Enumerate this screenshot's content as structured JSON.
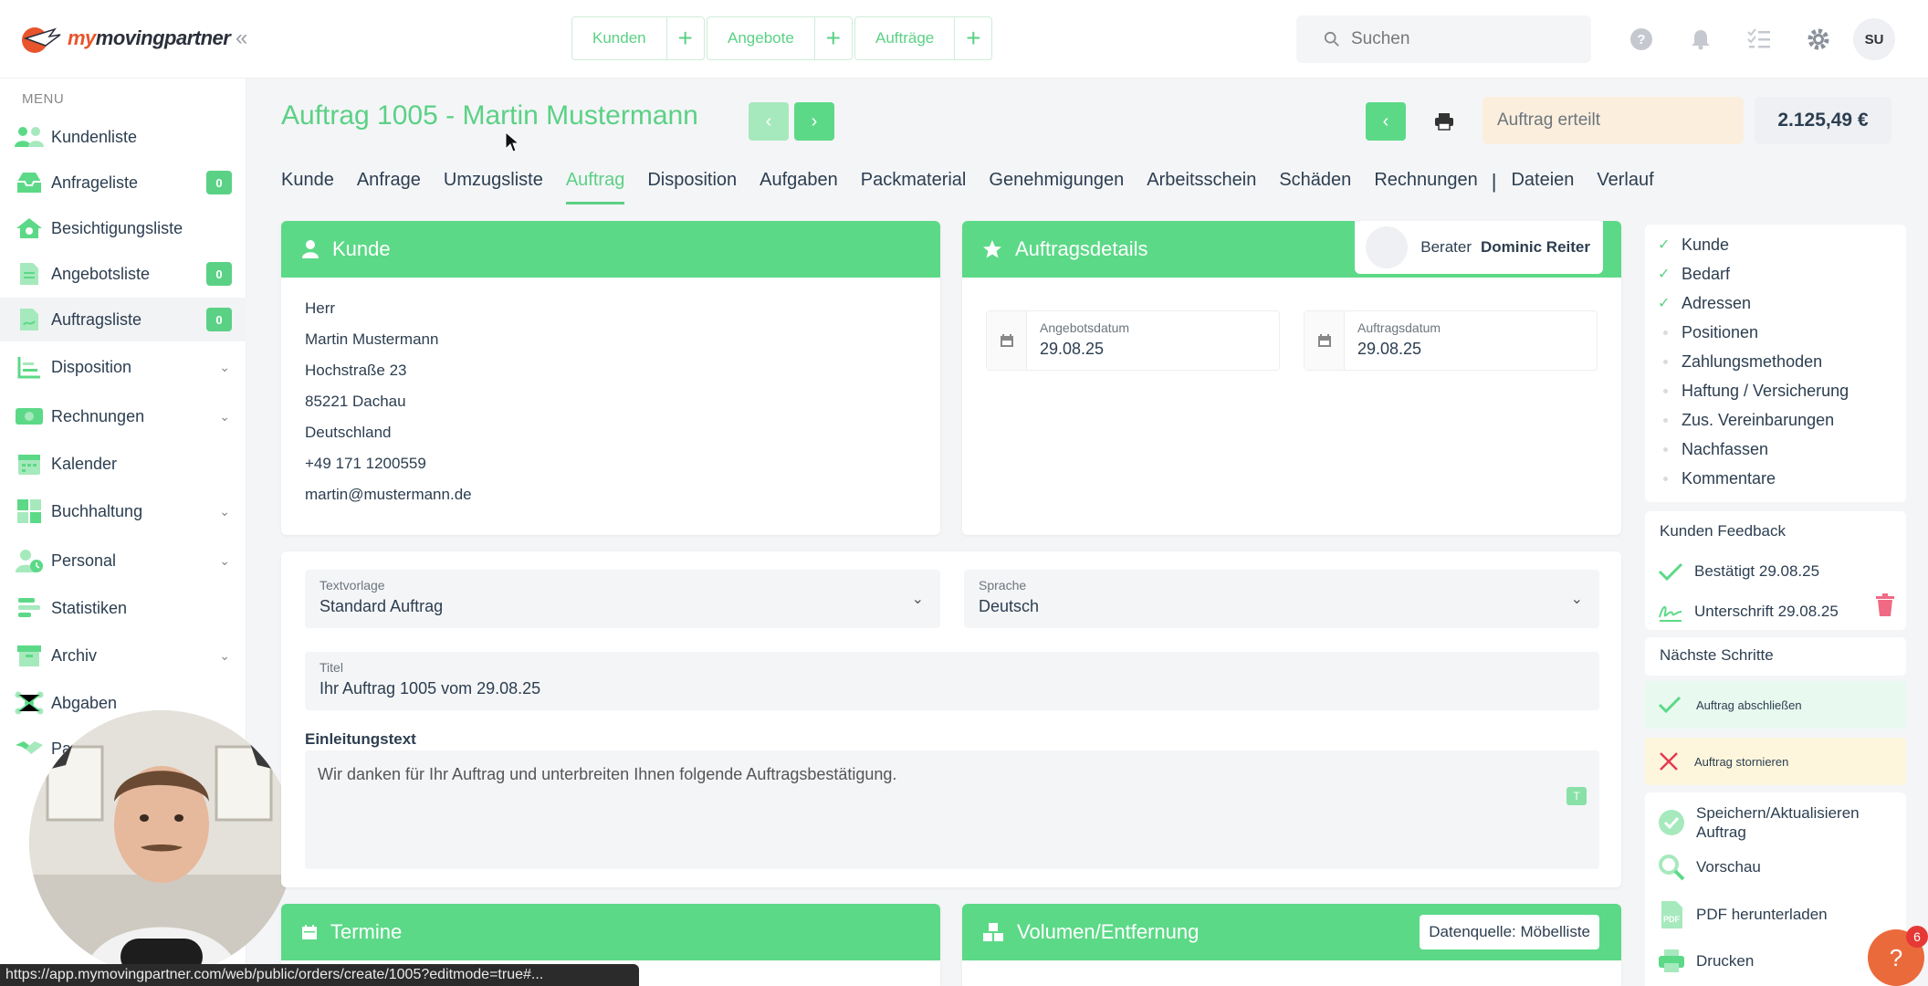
{
  "app": {
    "logo": "mymovingpartner",
    "logo_part1": "my",
    "logo_part2": "movingpartner"
  },
  "quick_actions": [
    {
      "label": "Kunden"
    },
    {
      "label": "Angebote"
    },
    {
      "label": "Aufträge"
    }
  ],
  "search": {
    "placeholder": "Suchen"
  },
  "user": {
    "initials": "SU"
  },
  "sidebar": {
    "menu_title": "MENU",
    "items": [
      {
        "label": "Kundenliste"
      },
      {
        "label": "Anfrageliste",
        "badge": "0"
      },
      {
        "label": "Besichtigungsliste"
      },
      {
        "label": "Angebotsliste",
        "badge": "0"
      },
      {
        "label": "Auftragsliste",
        "badge": "0"
      },
      {
        "label": "Disposition"
      },
      {
        "label": "Rechnungen"
      },
      {
        "label": "Kalender"
      },
      {
        "label": "Buchhaltung"
      },
      {
        "label": "Personal"
      },
      {
        "label": "Statistiken"
      },
      {
        "label": "Archiv"
      },
      {
        "label": "Abgaben"
      },
      {
        "label": "Pa"
      }
    ]
  },
  "page": {
    "title": "Auftrag 1005 - Martin Mustermann",
    "status": "Auftrag erteilt",
    "price": "2.125,49 €"
  },
  "tabs": [
    "Kunde",
    "Anfrage",
    "Umzugsliste",
    "Auftrag",
    "Disposition",
    "Aufgaben",
    "Packmaterial",
    "Genehmigungen",
    "Arbeitsschein",
    "Schäden",
    "Rechnungen",
    "Dateien",
    "Verlauf"
  ],
  "customer": {
    "header": "Kunde",
    "lines": [
      "Herr",
      "Martin Mustermann",
      "Hochstraße 23",
      "85221 Dachau",
      "Deutschland",
      "+49 171 1200559",
      "martin@mustermann.de"
    ]
  },
  "order_details": {
    "header": "Auftragsdetails",
    "advisor_label": "Berater",
    "advisor_name": "Dominic Reiter",
    "offer_date_label": "Angebotsdatum",
    "offer_date": "29.08.25",
    "order_date_label": "Auftragsdatum",
    "order_date": "29.08.25"
  },
  "form": {
    "template_label": "Textvorlage",
    "template_value": "Standard Auftrag",
    "language_label": "Sprache",
    "language_value": "Deutsch",
    "title_label": "Titel",
    "title_value": "Ihr Auftrag 1005 vom 29.08.25",
    "intro_label": "Einleitungstext",
    "intro_value": "Wir danken für Ihr Auftrag und unterbreiten Ihnen folgende Auftragsbestätigung.",
    "t_button": "T"
  },
  "bottom_cards": {
    "termine": "Termine",
    "volumen": "Volumen/Entfernung",
    "datenquelle": "Datenquelle: Möbelliste"
  },
  "checklist": [
    {
      "label": "Kunde",
      "done": true
    },
    {
      "label": "Bedarf",
      "done": true
    },
    {
      "label": "Adressen",
      "done": true
    },
    {
      "label": "Positionen",
      "done": false
    },
    {
      "label": "Zahlungsmethoden",
      "done": false
    },
    {
      "label": "Haftung / Versicherung",
      "done": false
    },
    {
      "label": "Zus. Vereinbarungen",
      "done": false
    },
    {
      "label": "Nachfassen",
      "done": false
    },
    {
      "label": "Kommentare",
      "done": false
    }
  ],
  "feedback": {
    "title": "Kunden Feedback",
    "confirmed": "Bestätigt 29.08.25",
    "signature": "Unterschrift 29.08.25"
  },
  "next_steps": {
    "title": "Nächste Schritte",
    "complete": "Auftrag abschließen",
    "cancel": "Auftrag stornieren"
  },
  "actions": {
    "save": "Speichern/Aktualisieren Auftrag",
    "preview": "Vorschau",
    "pdf": "PDF herunterladen",
    "print": "Drucken"
  },
  "status_url": "https://app.mymovingpartner.com/web/public/orders/create/1005?editmode=true#...",
  "help": {
    "icon": "?",
    "count": "6"
  },
  "colors": {
    "accent": "#5cd987",
    "brand": "#e8542c",
    "status_bg": "#fbeedd"
  }
}
